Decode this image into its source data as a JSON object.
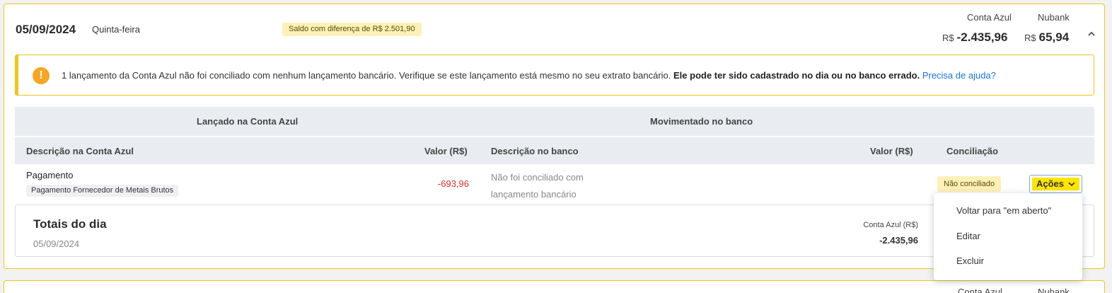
{
  "day": {
    "date": "05/09/2024",
    "weekday": "Quinta-feira",
    "diff_badge": "Saldo com diferença de R$ 2.501,90",
    "balances": [
      {
        "label": "Conta Azul",
        "currency": "R$",
        "value": "-2.435,96"
      },
      {
        "label": "Nubank",
        "currency": "R$",
        "value": "65,94"
      }
    ]
  },
  "alert": {
    "text": "1 lançamento da Conta Azul não foi conciliado com nenhum lançamento bancário. Verifique se este lançamento está mesmo no seu extrato bancário. ",
    "bold_text": "Ele pode ter sido cadastrado no dia ou no banco errado.",
    "link": "Precisa de ajuda?"
  },
  "table": {
    "group_left": "Lançado na Conta Azul",
    "group_right": "Movimentado no banco",
    "columns": {
      "desc_ca": "Descrição na Conta Azul",
      "val_ca": "Valor (R$)",
      "desc_bank": "Descrição no banco",
      "val_bank": "Valor (R$)",
      "reconcile": "Conciliação"
    },
    "row": {
      "description": "Pagamento",
      "tag": "Pagamento Fornecedor de Metais Brutos",
      "amount": "-693,96",
      "bank_description": "Não foi conciliado com lançamento bancário",
      "status": "Não conciliado",
      "actions_label": "Ações"
    }
  },
  "totals": {
    "title": "Totais do dia",
    "date": "05/09/2024",
    "label": "Conta Azul (R$)",
    "value": "-2.435,96"
  },
  "actions_menu": {
    "items": [
      "Voltar para \"em aberto\"",
      "Editar",
      "Excluir"
    ]
  },
  "next_day": {
    "balance_labels": [
      "Conta Azul",
      "Nubank"
    ]
  },
  "colors": {
    "accent_border": "#f0c419",
    "badge_bg": "#fdf0b8",
    "negative": "#d93025",
    "link": "#1a73e8",
    "highlight": "#ffe500"
  },
  "icons": {
    "alert": "exclamation-circle-icon",
    "collapse": "chevron-up-icon",
    "actions": "chevron-down-icon"
  }
}
